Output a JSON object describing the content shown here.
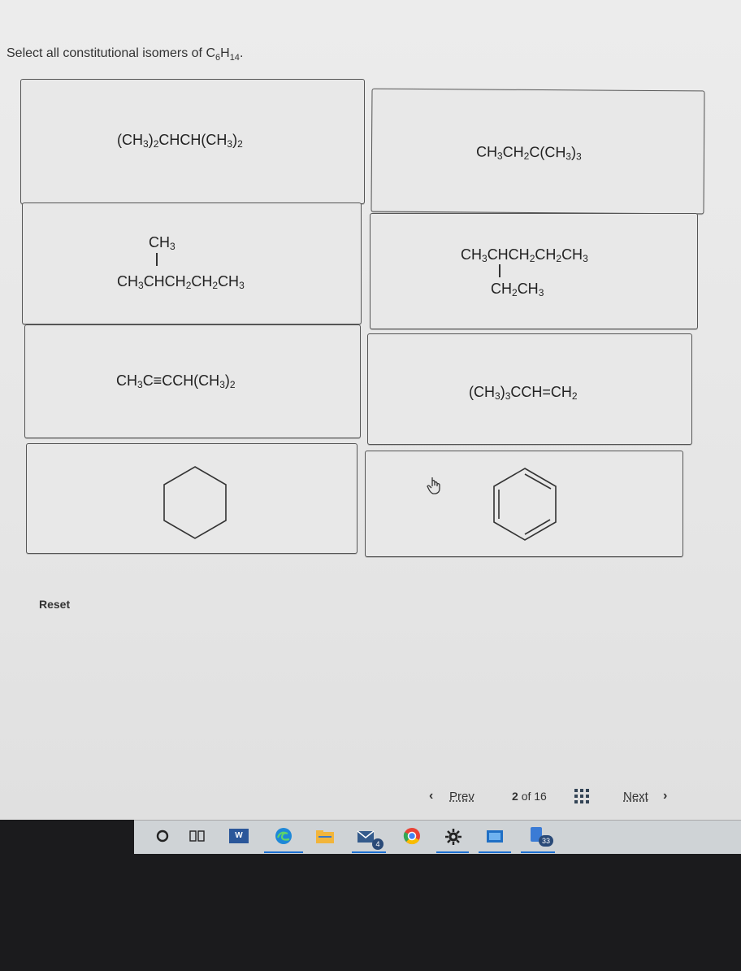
{
  "question": {
    "prefix": "Select all constitutional isomers of C",
    "sub1": "6",
    "mid": "H",
    "sub2": "14",
    "suffix": "."
  },
  "options": {
    "a": [
      "(CH",
      "3",
      ")",
      "2",
      "CHCH(CH",
      "3",
      ")",
      "2"
    ],
    "b": [
      "CH",
      "3",
      "CH",
      "2",
      "C(CH",
      "3",
      ")",
      "3"
    ],
    "c_top": [
      "CH",
      "3"
    ],
    "c_main": [
      "CH",
      "3",
      "CHCH",
      "2",
      "CH",
      "2",
      "CH",
      "3"
    ],
    "d_main": [
      "CH",
      "3",
      "CHCH",
      "2",
      "CH",
      "2",
      "CH",
      "3"
    ],
    "d_branch": [
      "CH",
      "2",
      "CH",
      "3"
    ],
    "e": [
      "CH",
      "3",
      "C≡CCH(CH",
      "3",
      ")",
      "2"
    ],
    "f": [
      "(CH",
      "3",
      ")",
      "3",
      "CCH=CH",
      "2"
    ]
  },
  "reset_label": "Reset",
  "nav": {
    "prev_label": "Prev",
    "page_current": "2",
    "page_of": "of",
    "page_total": "16",
    "next_label": "Next"
  },
  "taskbar": {
    "mail_badge": "4",
    "teams_badge": "33",
    "word_label": "W"
  }
}
